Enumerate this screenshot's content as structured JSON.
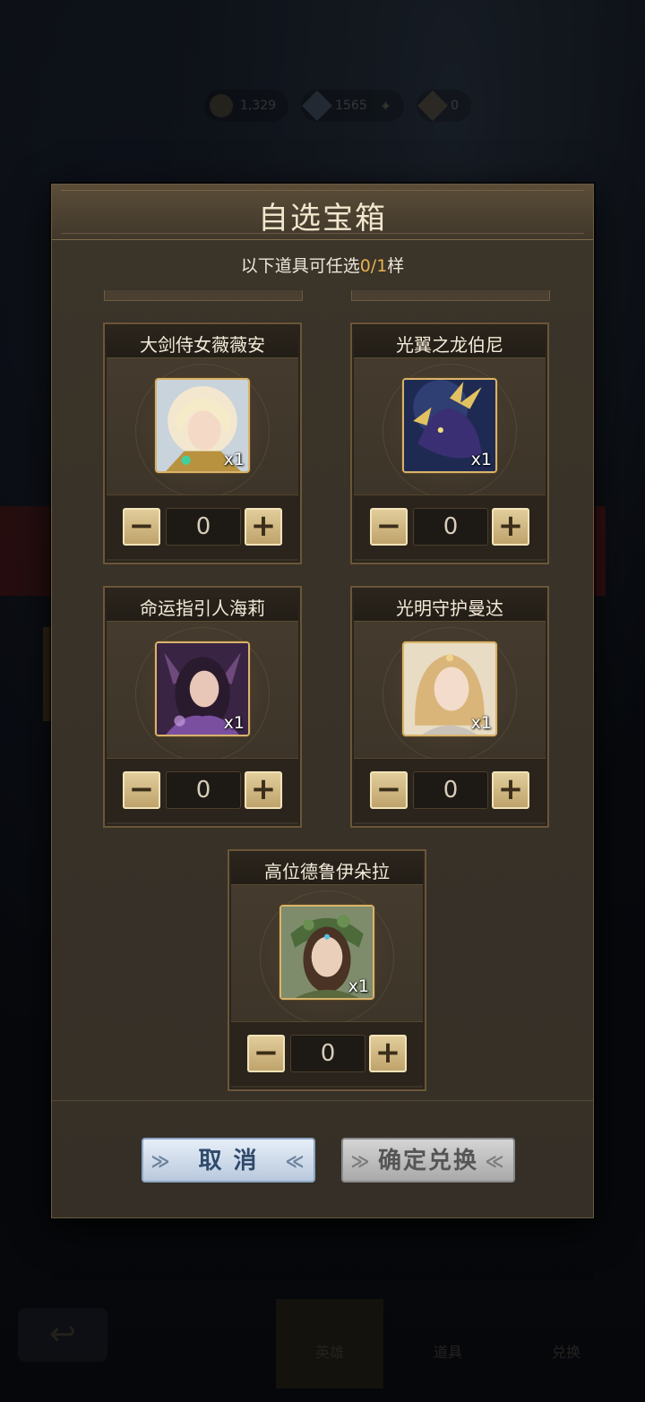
{
  "currency": [
    {
      "value": "1,329",
      "icon": "gold-coin-icon"
    },
    {
      "value": "1565",
      "icon": "diamond-icon"
    },
    {
      "value": "0",
      "icon": "gem-icon"
    }
  ],
  "bottom_nav": {
    "back_icon": "back-arrow-icon",
    "tabs": [
      "英雄",
      "道具",
      "兑换"
    ]
  },
  "modal": {
    "title": "自选宝箱",
    "subtitle_prefix": "以下道具可任选",
    "subtitle_count": "0/1",
    "subtitle_suffix": "样"
  },
  "items": [
    {
      "name": "大剑侍女薇薇安",
      "badge": "x1",
      "qty": "0",
      "portrait": "blonde-maiden-portrait"
    },
    {
      "name": "光翼之龙伯尼",
      "badge": "x1",
      "qty": "0",
      "portrait": "dragon-portrait"
    },
    {
      "name": "命运指引人海莉",
      "badge": "x1",
      "qty": "0",
      "portrait": "fox-eared-girl-portrait"
    },
    {
      "name": "光明守护曼达",
      "badge": "x1",
      "qty": "0",
      "portrait": "golden-hair-woman-portrait"
    },
    {
      "name": "高位德鲁伊朵拉",
      "badge": "x1",
      "qty": "0",
      "portrait": "druid-portrait"
    }
  ],
  "stepper": {
    "minus": "−",
    "plus": "+"
  },
  "buttons": {
    "cancel": "取 消",
    "confirm": "确定兑换"
  },
  "colors": {
    "accent": "#e8b24f",
    "panel": "#3b3429",
    "button_cancel": "#c9d6e6",
    "button_confirm_disabled": "#b5b5b5"
  }
}
